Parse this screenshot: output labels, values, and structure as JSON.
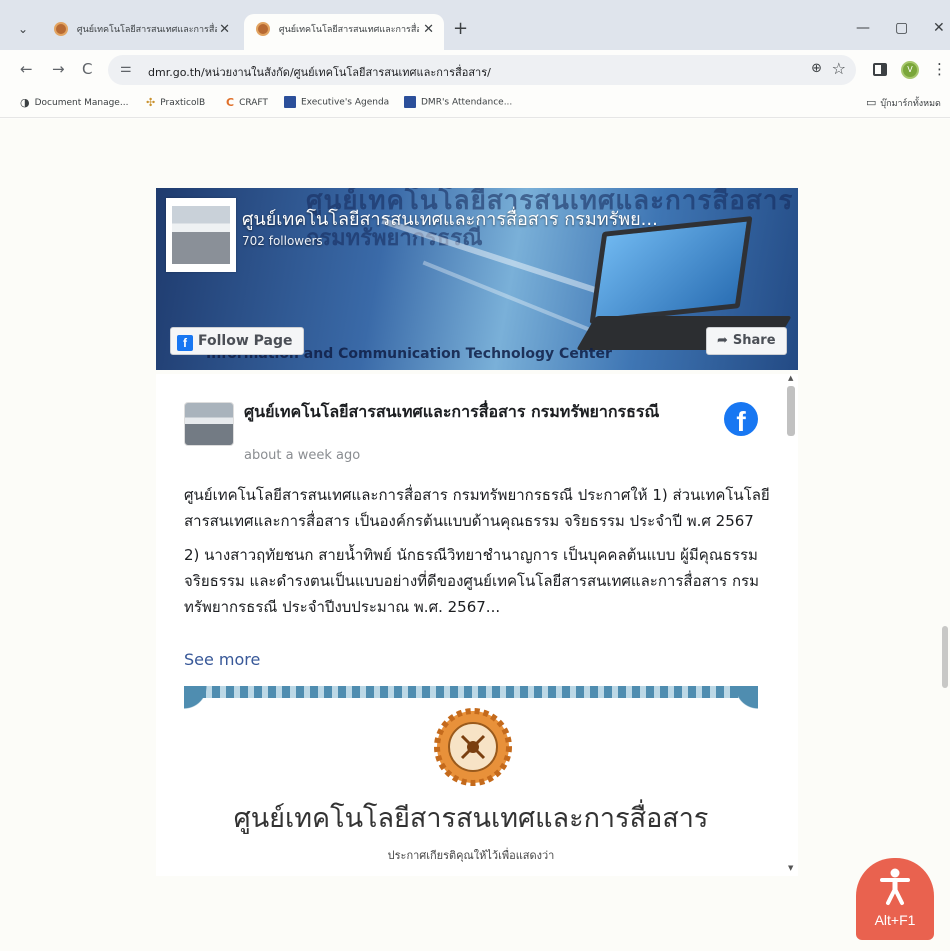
{
  "browser": {
    "tabs": [
      {
        "title": "ศูนย์เทคโนโลยีสารสนเทศและการสื่อ",
        "active": false
      },
      {
        "title": "ศูนย์เทคโนโลยีสารสนเทศและการสื่อ",
        "active": true
      }
    ],
    "new_tab_icon": "+",
    "url": "dmr.go.th/หน่วยงานในสังกัด/ศูนย์เทคโนโลยีสารสนเทศและการสื่อสาร/",
    "profile_initial": "V",
    "bookmarks": [
      {
        "label": "Document Manage...",
        "icon": "doc-icon"
      },
      {
        "label": "PraxticolB",
        "icon": "praxticol-icon"
      },
      {
        "label": "CRAFT",
        "icon": "craft-icon"
      },
      {
        "label": "Executive's Agenda",
        "icon": "agenda-icon"
      },
      {
        "label": "DMR's Attendance...",
        "icon": "attendance-icon"
      }
    ],
    "bookmark_folder": "บุ๊กมาร์กทั้งหมด"
  },
  "fb_plugin": {
    "page_name": "ศูนย์เทคโนโลยีสารสนเทศและการสื่อสาร กรมทรัพย...",
    "followers": "702 followers",
    "follow_label": "Follow Page",
    "share_label": "Share",
    "cover_text_1": "ศูนย์เทคโนโลยีสารสนเทศและการสื่อสาร",
    "cover_text_2": "กรมทรัพยากรธรณี",
    "cover_text_3": "Information and Communication Technology Center",
    "post": {
      "author": "ศูนย์เทคโนโลยีสารสนเทศและการสื่อสาร กรมทรัพยากรธรณี",
      "time": "about a week ago",
      "paragraph_1": "ศูนย์เทคโนโลยีสารสนเทศและการสื่อสาร กรมทรัพยากรธรณี ประกาศให้ 1) ส่วนเทคโนโลยีสารสนเทศและการสื่อสาร เป็นองค์กรต้นแบบด้านคุณธรรม จริยธรรม ประจำปี พ.ศ 2567",
      "paragraph_2": "2) นางสาวฤทัยชนก สายน้ำทิพย์ นักธรณีวิทยาชำนาญการ เป็นบุคคลต้นแบบ ผู้มีคุณธรรม จริยธรรม และดำรงตนเป็นแบบอย่างที่ดีของศูนย์เทคโนโลยีสารสนเทศและการสื่อสาร กรมทรัพยากรธรณี ประจำปีงบประมาณ พ.ศ. 2567...",
      "see_more": "See more",
      "image_title": "ศูนย์เทคโนโลยีสารสนเทศและการสื่อสาร",
      "image_subtitle": "ประกาศเกียรติคุณให้ไว้เพื่อแสดงว่า"
    }
  },
  "accessibility_button": {
    "label": "Alt+F1"
  },
  "colors": {
    "facebook_blue": "#1877f2",
    "link": "#385898",
    "fab": "#e9624f"
  }
}
